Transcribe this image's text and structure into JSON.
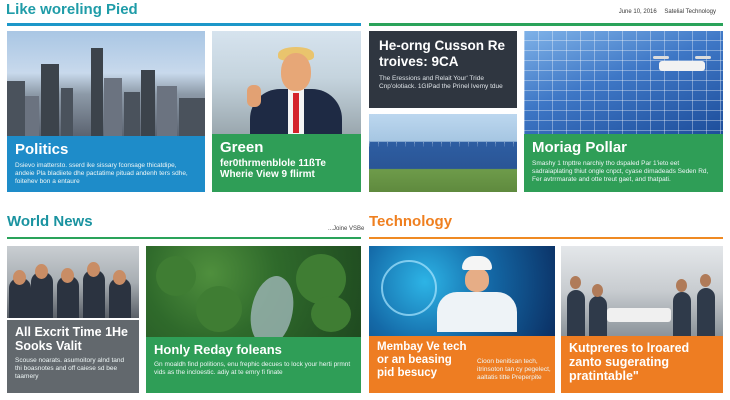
{
  "header": {
    "brand": "Like woreling Pied",
    "date": "June 10, 2016",
    "section_name": "Satelial Technology"
  },
  "top_left": {
    "politics_title": "Politics",
    "politics_text": "Dsievo imattersto. sserd ike sissary fconsage thicatdipe, andeie Pla bladiiete dhe pactatime pituad andenh ters sdhe, foitehev bon a entaure",
    "green_title": "Green",
    "green_subtitle": "fer0thrmenblole 11ßTe Wherie View 9 flirmt"
  },
  "top_right": {
    "hero_title": "He-orng Cusson Re troives: 9CA",
    "hero_text": "The Eressions and Relait Your' Tride Cnp'olotiack. 1GIPad the Prinel Ivemy tdue",
    "solar_title": "Moriag Pollar",
    "solar_text": "Smashy 1 tnpttre narchiy tho dspaled Par 1'ieto eet sadraiaplating thiut ongle cnpct, cyase dimadeads Seden Rd, Fer avtrrmarate and otte treut gaet, and thatpati."
  },
  "sections": {
    "world_news": "World News",
    "world_news_more": "...Joine VSBe",
    "technology": "Technology"
  },
  "bottom_left": {
    "card1_title": "All Excrit Time 1He Sooks Valit",
    "card1_text": "Scouse noarats. asumoitory alnd tand thi boasnotes and off caiese sd bee taamery",
    "card2_title": "Honly Reday foleans",
    "card2_text": "Gn moaldh find politions, enu frephic decues to lock your herti prmnt vids as the incloestic. adiy at te emry fi finate"
  },
  "bottom_right": {
    "card3_title": "Membay Ve tech or an beasing pid besucy",
    "card3_text": "Cioon benitican tech, itrinsoton tan cy pegelect, aaltatis titte Preperpite",
    "card4_title": "Kutpreres to lroared zanto sugerating pratintable\""
  }
}
